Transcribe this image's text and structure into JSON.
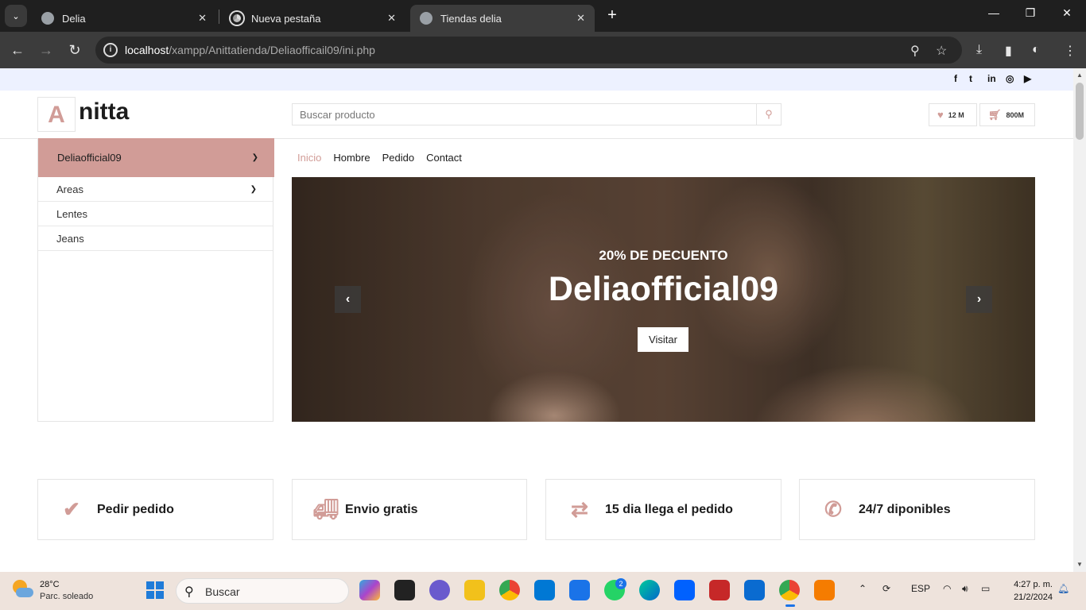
{
  "browser": {
    "tabs": [
      {
        "title": "Delia"
      },
      {
        "title": "Nueva pestaña"
      },
      {
        "title": "Tiendas delia"
      }
    ],
    "url_host": "localhost",
    "url_path": "/xampp/Anittatienda/Deliaofficail09/ini.php"
  },
  "site": {
    "logo_letter": "A",
    "logo_text": "nitta",
    "search_placeholder": "Buscar producto",
    "wishlist_count": "12 M",
    "cart_count": "800M"
  },
  "sidebar": {
    "header": "Deliaofficial09",
    "items": [
      {
        "label": "Areas"
      },
      {
        "label": "Lentes"
      },
      {
        "label": "Jeans"
      }
    ]
  },
  "nav": {
    "items": [
      "Inicio",
      "Hombre",
      "Pedido",
      "Contact"
    ]
  },
  "hero": {
    "subtitle": "20% DE DECUENTO",
    "title": "Deliaofficial09",
    "button": "Visitar"
  },
  "features": [
    {
      "icon": "check-icon",
      "text": "Pedir pedido"
    },
    {
      "icon": "truck-icon",
      "text": "Envio gratis"
    },
    {
      "icon": "exchange-icon",
      "text": "15 dia llega el pedido"
    },
    {
      "icon": "phone-icon",
      "text": "24/7 diponibles"
    }
  ],
  "taskbar": {
    "temperature": "28°C",
    "weather": "Parc. soleado",
    "search_label": "Buscar",
    "language": "ESP",
    "time": "4:27 p. m.",
    "date": "21/2/2024",
    "whatsapp_badge": "2"
  },
  "colors": {
    "accent": "#d19c97",
    "topbar": "#edf1ff"
  }
}
